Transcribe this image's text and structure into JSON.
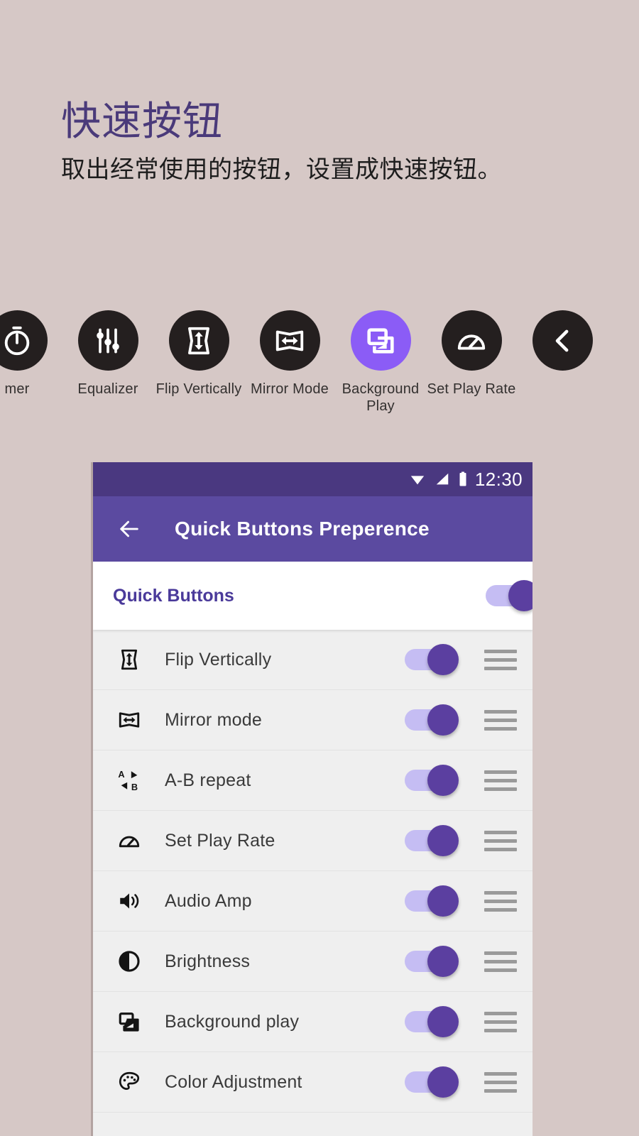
{
  "promo": {
    "title": "快速按钮",
    "subtitle": "取出经常使用的按钮，设置成快速按钮。"
  },
  "icon_strip": {
    "items": [
      {
        "label": "mer",
        "icon": "timer-icon",
        "active": false,
        "partial": true
      },
      {
        "label": "Equalizer",
        "icon": "equalizer-icon",
        "active": false
      },
      {
        "label": "Flip Vertically",
        "icon": "flip-vertical-icon",
        "active": false
      },
      {
        "label": "Mirror Mode",
        "icon": "mirror-mode-icon",
        "active": false
      },
      {
        "label": "Background Play",
        "icon": "background-play-icon",
        "active": true
      },
      {
        "label": "Set Play Rate",
        "icon": "play-rate-icon",
        "active": false
      },
      {
        "label": "",
        "icon": "chevron-left-icon",
        "active": false
      }
    ]
  },
  "phone": {
    "statusbar": {
      "time": "12:30",
      "icons": [
        "wifi-icon",
        "signal-icon",
        "battery-icon"
      ]
    },
    "appbar": {
      "back_icon": "back-arrow-icon",
      "title": "Quick Buttons Preperence"
    },
    "master": {
      "label": "Quick Buttons",
      "enabled": true
    },
    "rows": [
      {
        "label": "Flip Vertically",
        "icon": "flip-vertical-icon",
        "enabled": true,
        "handle": "drag-handle-icon"
      },
      {
        "label": "Mirror mode",
        "icon": "mirror-mode-icon",
        "enabled": true,
        "handle": "drag-handle-icon"
      },
      {
        "label": "A-B repeat",
        "icon": "ab-repeat-icon",
        "enabled": true,
        "handle": "drag-handle-icon"
      },
      {
        "label": "Set Play Rate",
        "icon": "play-rate-icon",
        "enabled": true,
        "handle": "drag-handle-icon"
      },
      {
        "label": "Audio Amp",
        "icon": "audio-amp-icon",
        "enabled": true,
        "handle": "drag-handle-icon"
      },
      {
        "label": "Brightness",
        "icon": "brightness-icon",
        "enabled": true,
        "handle": "drag-handle-icon"
      },
      {
        "label": "Background play",
        "icon": "background-play-icon",
        "enabled": true,
        "handle": "drag-handle-icon"
      },
      {
        "label": "Color Adjustment",
        "icon": "color-adjust-icon",
        "enabled": true,
        "handle": "drag-handle-icon"
      }
    ]
  },
  "colors": {
    "page_background": "#d6c8c6",
    "title_purple": "#4a3a7a",
    "statusbar_purple": "#4a3880",
    "appbar_purple": "#5b4aa0",
    "accent_purple": "#5b3fa0",
    "track_purple": "#c5bdf3",
    "highlight_circle": "#8b5cf6",
    "icon_circle_dark": "#241f1f"
  }
}
